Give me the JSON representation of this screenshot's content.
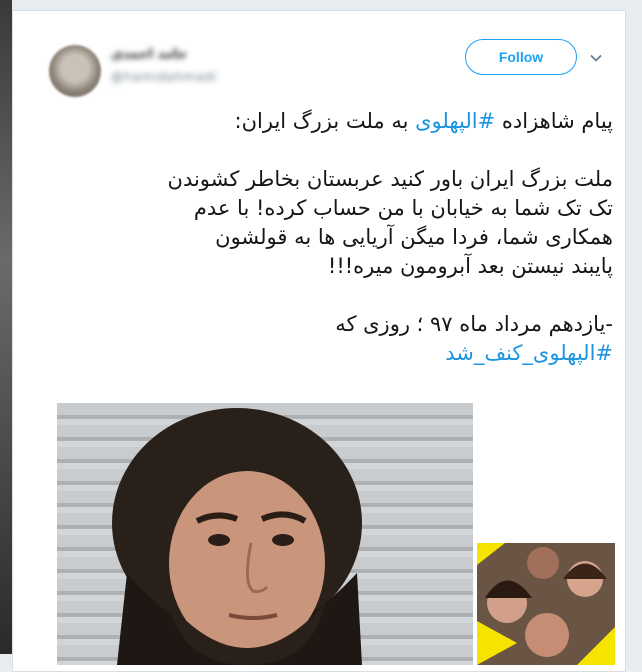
{
  "tweet": {
    "author_name": "حامد احمدی",
    "author_handle": "@hamidahmadi",
    "follow_label": "Follow",
    "lines": [
      {
        "segments": [
          {
            "text": "پیام شاهزاده ",
            "hashtag": false
          },
          {
            "text": "#الپهلوی",
            "hashtag": true
          },
          {
            "text": " به ملت بزرگ ایران:",
            "hashtag": false
          }
        ]
      },
      {
        "gap": true
      },
      {
        "segments": [
          {
            "text": "ملت بزرگ ایران باور کنید عربستان بخاطر کشوندن",
            "hashtag": false
          }
        ]
      },
      {
        "segments": [
          {
            "text": "تک تک شما به خیابان با من حساب کرده! با عدم",
            "hashtag": false
          }
        ]
      },
      {
        "segments": [
          {
            "text": "همکاری شما، فردا میگن آریایی ها به قولشون",
            "hashtag": false
          }
        ]
      },
      {
        "segments": [
          {
            "text": "پایبند نیستن بعد آبرومون میره!!!",
            "hashtag": false
          }
        ]
      },
      {
        "gap": true
      },
      {
        "segments": [
          {
            "text": "-یازدهم مرداد ماه ۹۷ ؛ روزی که",
            "hashtag": false
          }
        ]
      },
      {
        "segments": [
          {
            "text": "#الپهلوی_کنف_شد",
            "hashtag": true
          }
        ]
      }
    ]
  },
  "colors": {
    "accent": "#1da1f2",
    "hashtag": "#1b95e0",
    "text": "#14171a",
    "secondary": "#657786",
    "highlight_yellow": "#f4e400"
  },
  "icons": {
    "caret": "chevron-down-icon"
  }
}
